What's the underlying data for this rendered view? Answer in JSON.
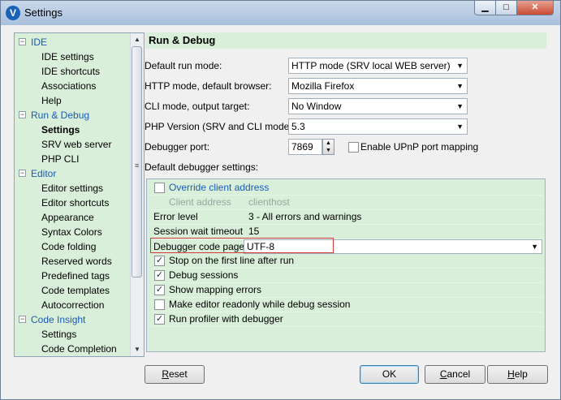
{
  "window": {
    "title": "Settings",
    "app_icon": "phped-logo",
    "controls": {
      "minimize": "▁",
      "maximize": "□",
      "close": "✕"
    }
  },
  "tree": {
    "items": [
      {
        "label": "IDE",
        "kind": "category",
        "expander": "−"
      },
      {
        "label": "IDE settings",
        "kind": "item"
      },
      {
        "label": "IDE shortcuts",
        "kind": "item"
      },
      {
        "label": "Associations",
        "kind": "item"
      },
      {
        "label": "Help",
        "kind": "item"
      },
      {
        "label": "Run & Debug",
        "kind": "category",
        "expander": "−"
      },
      {
        "label": "Settings",
        "kind": "item",
        "selected": true
      },
      {
        "label": "SRV web server",
        "kind": "item"
      },
      {
        "label": "PHP CLI",
        "kind": "item"
      },
      {
        "label": "Editor",
        "kind": "category",
        "expander": "−"
      },
      {
        "label": "Editor settings",
        "kind": "item"
      },
      {
        "label": "Editor shortcuts",
        "kind": "item"
      },
      {
        "label": "Appearance",
        "kind": "item"
      },
      {
        "label": "Syntax Colors",
        "kind": "item"
      },
      {
        "label": "Code folding",
        "kind": "item"
      },
      {
        "label": "Reserved words",
        "kind": "item"
      },
      {
        "label": "Predefined tags",
        "kind": "item"
      },
      {
        "label": "Code templates",
        "kind": "item"
      },
      {
        "label": "Autocorrection",
        "kind": "item"
      },
      {
        "label": "Code Insight",
        "kind": "category",
        "expander": "−"
      },
      {
        "label": "Settings",
        "kind": "item"
      },
      {
        "label": "Code Completion",
        "kind": "item"
      }
    ],
    "scroll_up": "▲",
    "scroll_down": "▼",
    "scroll_grip": "≡"
  },
  "page": {
    "title": "Run & Debug",
    "default_run_mode": {
      "label": "Default run mode:",
      "value": "HTTP mode (SRV local WEB server)"
    },
    "http_browser": {
      "label": "HTTP mode, default browser:",
      "value": "Mozilla Firefox"
    },
    "cli_output": {
      "label": "CLI mode, output target:",
      "value": "No Window"
    },
    "php_version": {
      "label": "PHP Version (SRV and CLI modes):",
      "value": "5.3"
    },
    "debugger_port": {
      "label": "Debugger port:",
      "value": "7869"
    },
    "upnp": {
      "label": "Enable UPnP port mapping",
      "checked": false
    },
    "combo_arrow": "▼",
    "spin_up": "▲",
    "spin_down": "▼"
  },
  "debugger_settings": {
    "heading": "Default debugger settings:",
    "override": {
      "label": "Override client address",
      "checked": false
    },
    "client_address": {
      "label": "Client address",
      "value": "clienthost"
    },
    "error_level": {
      "label": "Error level",
      "value": "3 - All errors and warnings"
    },
    "session_timeout": {
      "label": "Session wait timeout",
      "value": "15"
    },
    "code_page": {
      "label": "Debugger code page",
      "value": "UTF-8"
    },
    "options": [
      {
        "label": "Stop on the first line after run",
        "checked": true
      },
      {
        "label": "Debug sessions",
        "checked": true
      },
      {
        "label": "Show mapping errors",
        "checked": true
      },
      {
        "label": "Make editor readonly while debug session",
        "checked": false
      },
      {
        "label": "Run profiler with debugger",
        "checked": true
      }
    ]
  },
  "buttons": {
    "reset": {
      "first": "R",
      "rest": "eset"
    },
    "ok": "OK",
    "cancel": {
      "first": "C",
      "rest": "ancel"
    },
    "help": {
      "first": "H",
      "rest": "elp"
    }
  },
  "colors": {
    "panel_green": "#d9efd9",
    "category_blue": "#1a5cb3",
    "highlight_red": "#d43a3a"
  }
}
